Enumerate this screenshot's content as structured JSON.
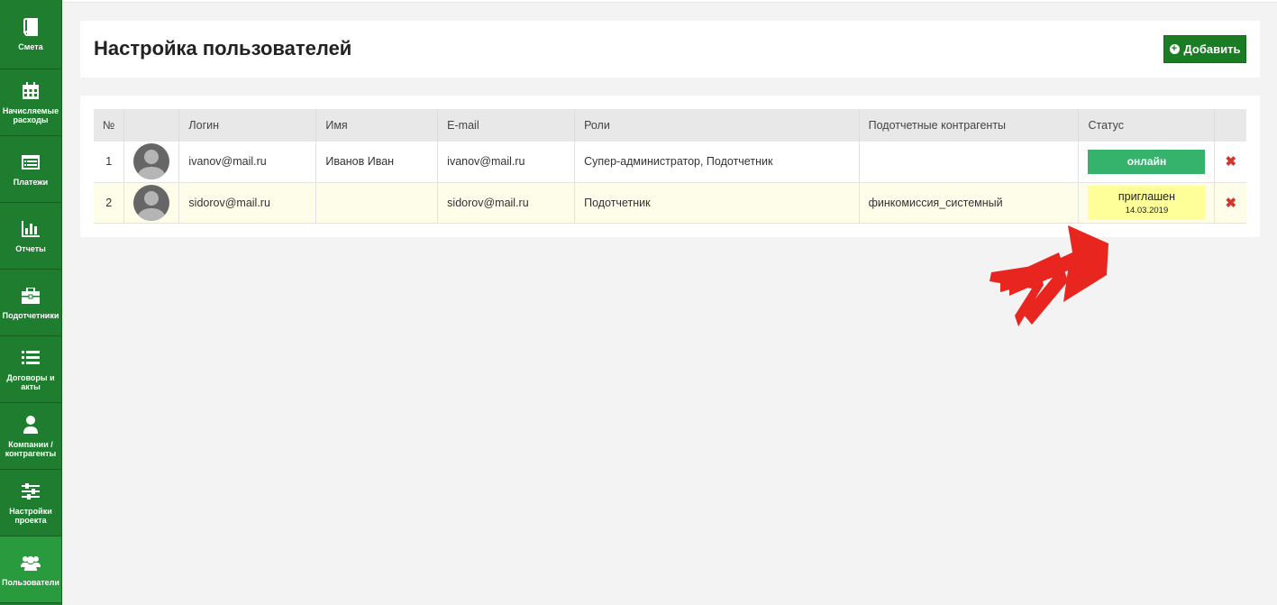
{
  "sidebar": {
    "items": [
      {
        "label": "Смета",
        "icon": "book-icon"
      },
      {
        "label": "Начисляемые расходы",
        "icon": "calendar-icon"
      },
      {
        "label": "Платежи",
        "icon": "list-window-icon"
      },
      {
        "label": "Отчеты",
        "icon": "bar-chart-icon"
      },
      {
        "label": "Подотчетники",
        "icon": "briefcase-icon"
      },
      {
        "label": "Договоры и акты",
        "icon": "list-icon"
      },
      {
        "label": "Компании / контрагенты",
        "icon": "user-icon"
      },
      {
        "label": "Настройки проекта",
        "icon": "sliders-icon"
      },
      {
        "label": "Пользователи",
        "icon": "users-icon"
      }
    ]
  },
  "header": {
    "title": "Настройка пользователей",
    "add_label": "Добавить"
  },
  "table": {
    "columns": [
      "№",
      "",
      "Логин",
      "Имя",
      "E-mail",
      "Роли",
      "Подотчетные контрагенты",
      "Статус",
      ""
    ],
    "rows": [
      {
        "num": "1",
        "login": "ivanov@mail.ru",
        "name": "Иванов Иван",
        "email": "ivanov@mail.ru",
        "roles": "Супер-администратор, Подотчетник",
        "accounts": "",
        "status": "онлайн",
        "status_date": ""
      },
      {
        "num": "2",
        "login": "sidorov@mail.ru",
        "name": "",
        "email": "sidorov@mail.ru",
        "roles": "Подотчетник",
        "accounts": "финкомиссия_системный",
        "status": "приглашен",
        "status_date": "14.03.2019"
      }
    ]
  },
  "colors": {
    "sidebar": "#1e7d2f",
    "sidebar_active": "#2a9a3e",
    "online": "#35b36c",
    "invited": "#ffff99",
    "delete": "#d9342b",
    "arrows": "#e8251f"
  }
}
